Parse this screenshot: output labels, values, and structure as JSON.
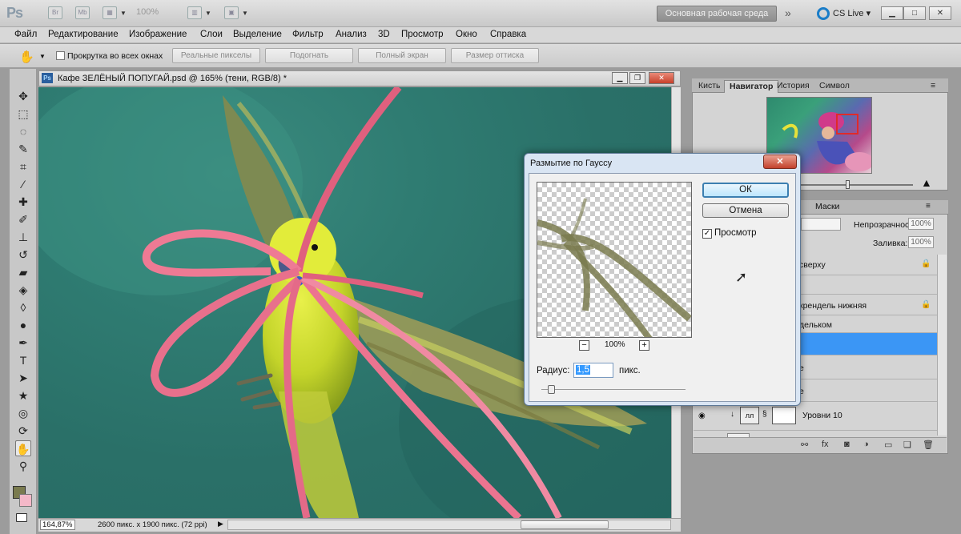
{
  "app": {
    "logo": "Ps",
    "zoom": "100%",
    "workspace": "Основная рабочая среда",
    "cslive": "CS Live"
  },
  "menu": [
    "Файл",
    "Редактирование",
    "Изображение",
    "Слои",
    "Выделение",
    "Фильтр",
    "Анализ",
    "3D",
    "Просмотр",
    "Окно",
    "Справка"
  ],
  "options": {
    "scroll_all": "Прокрутка во всех окнах",
    "buttons": [
      "Реальные пикселы",
      "Подогнать",
      "Полный экран",
      "Размер оттиска"
    ]
  },
  "document": {
    "title": "Кафе ЗЕЛЁНЫЙ ПОПУГАЙ.psd @ 165% (тени, RGB/8) *",
    "zoom": "164,87%",
    "info": "2600 пикс. x 1900 пикс. (72 ppi)"
  },
  "navigator": {
    "tabs": [
      "Кисть",
      "Навигатор",
      "История",
      "Символ"
    ]
  },
  "layers": {
    "tab_masks": "Маски",
    "opacity_label": "Непрозрачность:",
    "opacity_value": "100%",
    "fill_label": "Заливка:",
    "fill_value": "100%",
    "rows": [
      "сверху",
      "",
      "крендель нижняя",
      "дельком",
      "",
      "е",
      "е"
    ],
    "levels_name": "Уровни 10",
    "levels_icon": "лл"
  },
  "dialog": {
    "title": "Размытие по Гауссу",
    "ok": "ОК",
    "cancel": "Отмена",
    "preview_label": "Просмотр",
    "preview_checked": true,
    "zoom_pct": "100%",
    "radius_label": "Радиус:",
    "radius_value": "1,5",
    "radius_unit": "пикс."
  },
  "colors": {
    "foreground": "#7a7b4f",
    "background": "#f4b8c8",
    "selection": "#3b96f5"
  }
}
